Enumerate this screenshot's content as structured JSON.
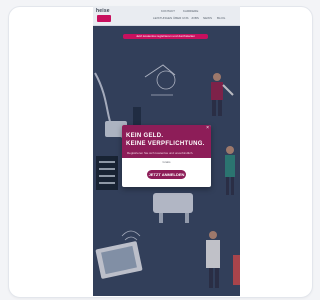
{
  "site": {
    "logo_text": "heise",
    "nav_top": [
      "KONTAKT",
      "KARRIERE"
    ],
    "nav_items": [
      "LEISTUNGEN",
      "ÜBER UNS",
      "JOBS",
      "NEWS",
      "BLOG"
    ],
    "banner_text": "Jetzt kostenlos registrieren und durchstarten"
  },
  "modal": {
    "close_glyph": "×",
    "headline_1": "KEIN GELD.",
    "headline_2": "KEINE VERPFLICHTUNG.",
    "subtext": "Registrieren Sie sich kostenlos und unverbindlich.",
    "small_text": "Gratis",
    "cta_label": "JETZT ANMELDEN"
  },
  "colors": {
    "brand_magenta": "#c8105e",
    "modal_header": "#8d1d58",
    "illustration_bg": "#2f4559"
  }
}
